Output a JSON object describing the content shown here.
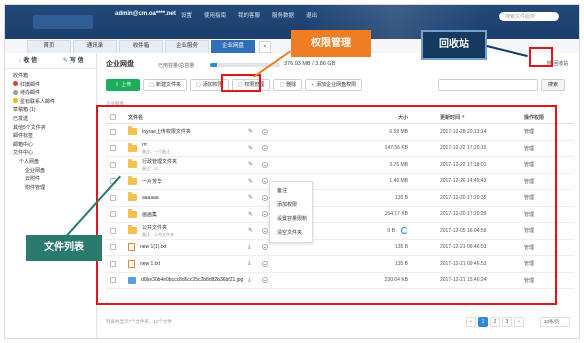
{
  "topbar": {
    "account": "admin@cm.oa****.net",
    "links": [
      "设置",
      "使用指南",
      "我的客服",
      "服务数据",
      "退出"
    ],
    "search_placeholder": "搜索文件服务"
  },
  "tabs": [
    {
      "label": "首页",
      "active": false
    },
    {
      "label": "通讯录",
      "active": false
    },
    {
      "label": "收件箱",
      "active": false
    },
    {
      "label": "企业服务",
      "active": false
    },
    {
      "label": "企业网盘",
      "active": true
    }
  ],
  "tab_close": "×",
  "sidebar": {
    "receive_label": "收 信",
    "compose_label": "写 信",
    "items": [
      {
        "label": "收件箱",
        "level": 1
      },
      {
        "label": "红旗邮件",
        "level": 1,
        "dot": "#e23b3b"
      },
      {
        "label": "待办邮件",
        "level": 1,
        "dot": "#999999"
      },
      {
        "label": "星标联系人邮件",
        "level": 1,
        "dot": "#f0b400"
      },
      {
        "label": "草稿箱 (1)",
        "level": 1
      },
      {
        "label": "已发送",
        "level": 1
      },
      {
        "label": "其他5个文件夹",
        "level": 1
      },
      {
        "label": "邮件标签",
        "level": 1
      },
      {
        "label": "邮箱中心",
        "level": 1
      },
      {
        "label": "文件中心",
        "level": 1
      },
      {
        "label": "个人网盘",
        "level": 2
      },
      {
        "label": "企业网盘",
        "level": 3
      },
      {
        "label": "云附件",
        "level": 3
      },
      {
        "label": "附件管理",
        "level": 3
      }
    ]
  },
  "main": {
    "title": "企业网盘",
    "quota_label": "已用容量/总容量",
    "quota_value": "376.93 MB / 3.86 GB",
    "quota_fraction": 0.095,
    "recycle_label": "回收站",
    "search_button": "搜索",
    "breadcrumb": "企业网盘",
    "toolbar": {
      "upload": "上传",
      "new_folder": "新建文件夹",
      "add_permission": "添加权限",
      "manage_permission": "权限管理",
      "delete": "删除",
      "add_enterprise_permission": "添加企业网盘权限"
    },
    "table": {
      "headers": {
        "name": "文件名",
        "size": "大小",
        "time": "更新时间",
        "op": "操作权限"
      },
      "rows": [
        {
          "name": "Inyrae上传权限文件夹",
          "desc": "",
          "type": "folder",
          "size": "6.59 MB",
          "time": "2017-12-28 20:13:14",
          "op": "管理"
        },
        {
          "name": "rrr",
          "desc": "备注：一个备注",
          "type": "folder",
          "size": "147.56 KB",
          "time": "2017-12-22 17:26:15",
          "op": "管理"
        },
        {
          "name": "行政管理文件夹",
          "desc": "备注：11",
          "type": "folder",
          "size": "3.76 MB",
          "time": "2017-12-22 17:18:01",
          "op": "管理"
        },
        {
          "name": "一片芳华",
          "desc": "",
          "type": "folder",
          "size": "1.46 MB",
          "time": "2017-12-26 14:49:43",
          "op": "管理"
        },
        {
          "name": "aaaaaa",
          "desc": "",
          "type": "folder",
          "size": "135 B",
          "time": "2017-12-20 17:20:35",
          "op": "管理"
        },
        {
          "name": "画画集",
          "desc": "",
          "type": "folder",
          "size": "154.17 KB",
          "time": "2017-12-20 17:20:29",
          "op": "管理"
        },
        {
          "name": "公共文件夹",
          "desc": "备注：公共文件夹",
          "type": "folder",
          "size": "0 B",
          "time": "2017-12-05 16:04:59",
          "op": "管理"
        },
        {
          "name": "new 1(1).txt",
          "desc": "",
          "type": "txt",
          "size": "135 B",
          "time": "2017-12-21 09:46:53",
          "op": "管理"
        },
        {
          "name": "new 1.txt",
          "desc": "",
          "type": "txt",
          "size": "135 B",
          "time": "2017-12-21 09:46:53",
          "op": "管理"
        },
        {
          "name": "d0be30b4e0bccc8d6cc35c2b8d82b36bf21.jpg",
          "desc": "",
          "type": "img",
          "size": "230.04 KB",
          "time": "2017-12-21 15:46:24",
          "op": "管理"
        }
      ]
    },
    "context_menu": [
      "备注",
      "添加权限",
      "设置容量限制",
      "清空文件夹"
    ],
    "footer": {
      "summary_prefix": "列表共显示",
      "summary_total": "7个文件夹",
      "summary_files": "10个文件",
      "pages": [
        "‹",
        "1",
        "2",
        "3",
        "›"
      ],
      "active_page": "1",
      "per_page": "10条/页"
    }
  },
  "callouts": {
    "permission": "权限管理",
    "recycle": "回收站",
    "file_list": "文件列表"
  },
  "colors": {
    "topbar": "#1b3d6b",
    "accent_blue": "#2e8ad8",
    "upload_green": "#1aae5a",
    "annotation_red": "#e4141b",
    "callout_orange": "#ee7d23",
    "callout_navy": "#15395f",
    "callout_teal": "#2a7b6d"
  }
}
